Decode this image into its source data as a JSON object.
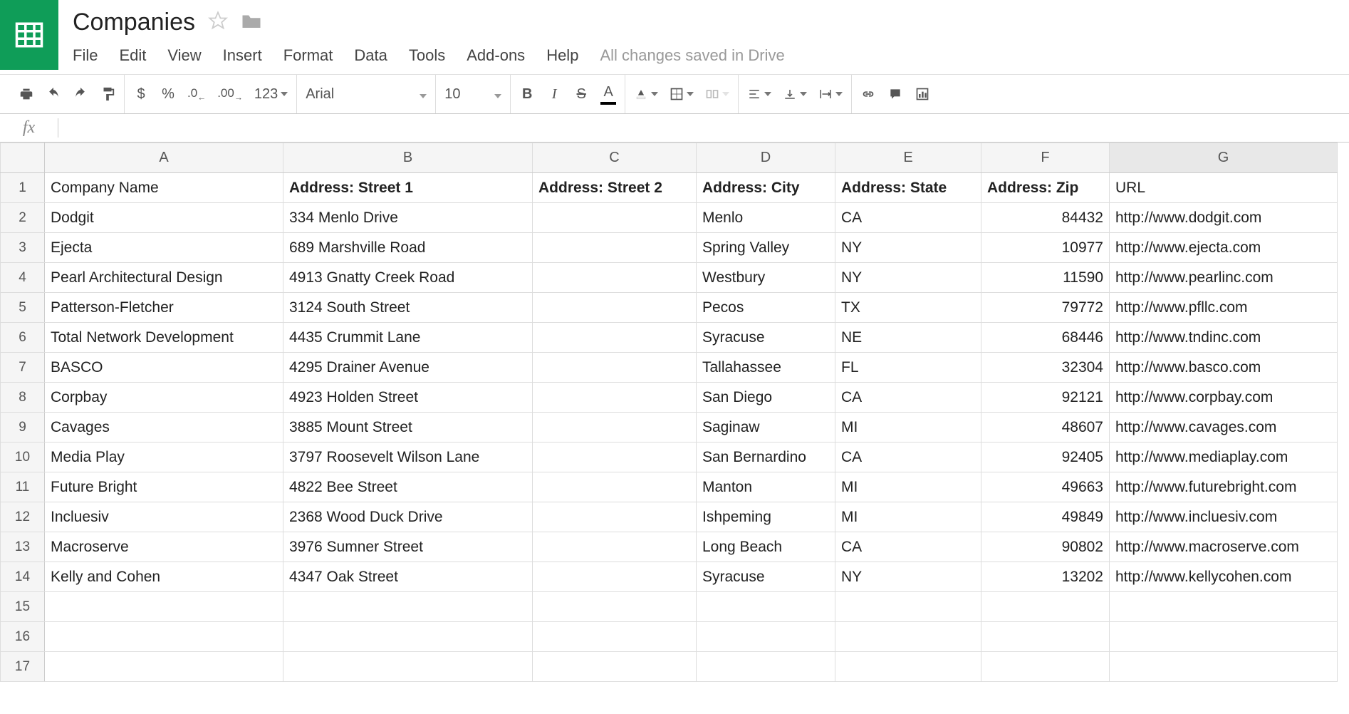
{
  "doc": {
    "title": "Companies",
    "save_status": "All changes saved in Drive"
  },
  "menu": {
    "file": "File",
    "edit": "Edit",
    "view": "View",
    "insert": "Insert",
    "format": "Format",
    "data": "Data",
    "tools": "Tools",
    "addons": "Add-ons",
    "help": "Help"
  },
  "toolbar": {
    "currency": "$",
    "percent": "%",
    "dec_dec": ".0",
    "dec_inc": ".00",
    "num_format": "123",
    "font": "Arial",
    "size": "10",
    "bold": "B",
    "italic": "I",
    "strike": "S",
    "text_color": "A"
  },
  "formula": {
    "fx": "fx",
    "value": ""
  },
  "columns": [
    "A",
    "B",
    "C",
    "D",
    "E",
    "F",
    "G"
  ],
  "selected_col_index": 6,
  "header_row": {
    "A": "Company Name",
    "B": "Address: Street 1",
    "C": "Address: Street 2",
    "D": "Address: City",
    "E": "Address: State",
    "F": "Address: Zip",
    "G": "URL",
    "bold_cols": [
      "B",
      "C",
      "D",
      "E",
      "F"
    ]
  },
  "rows": [
    {
      "A": "Dodgit",
      "B": "334 Menlo Drive",
      "C": "",
      "D": "Menlo",
      "E": "CA",
      "F": "84432",
      "G": "http://www.dodgit.com"
    },
    {
      "A": "Ejecta",
      "B": "689 Marshville Road",
      "C": "",
      "D": "Spring Valley",
      "E": "NY",
      "F": "10977",
      "G": "http://www.ejecta.com"
    },
    {
      "A": "Pearl Architectural Design",
      "B": "4913 Gnatty Creek Road",
      "C": "",
      "D": "Westbury",
      "E": "NY",
      "F": "11590",
      "G": "http://www.pearlinc.com"
    },
    {
      "A": "Patterson-Fletcher",
      "B": "3124 South Street",
      "C": "",
      "D": "Pecos",
      "E": "TX",
      "F": "79772",
      "G": "http://www.pfllc.com"
    },
    {
      "A": "Total Network Development",
      "B": "4435 Crummit Lane",
      "C": "",
      "D": "Syracuse",
      "E": "NE",
      "F": "68446",
      "G": "http://www.tndinc.com"
    },
    {
      "A": "BASCO",
      "B": "4295 Drainer Avenue",
      "C": "",
      "D": "Tallahassee",
      "E": "FL",
      "F": "32304",
      "G": "http://www.basco.com"
    },
    {
      "A": "Corpbay",
      "B": "4923 Holden Street",
      "C": "",
      "D": "San Diego",
      "E": "CA",
      "F": "92121",
      "G": "http://www.corpbay.com"
    },
    {
      "A": "Cavages",
      "B": "3885 Mount Street",
      "C": "",
      "D": "Saginaw",
      "E": "MI",
      "F": "48607",
      "G": "http://www.cavages.com"
    },
    {
      "A": "Media Play",
      "B": "3797 Roosevelt Wilson Lane",
      "C": "",
      "D": "San Bernardino",
      "E": "CA",
      "F": "92405",
      "G": "http://www.mediaplay.com"
    },
    {
      "A": "Future Bright",
      "B": "4822 Bee Street",
      "C": "",
      "D": "Manton",
      "E": "MI",
      "F": "49663",
      "G": "http://www.futurebright.com"
    },
    {
      "A": "Incluesiv",
      "B": "2368 Wood Duck Drive",
      "C": "",
      "D": "Ishpeming",
      "E": "MI",
      "F": "49849",
      "G": "http://www.incluesiv.com"
    },
    {
      "A": "Macroserve",
      "B": "3976 Sumner Street",
      "C": "",
      "D": "Long Beach",
      "E": "CA",
      "F": "90802",
      "G": "http://www.macroserve.com"
    },
    {
      "A": "Kelly and Cohen",
      "B": "4347 Oak Street",
      "C": "",
      "D": "Syracuse",
      "E": "NY",
      "F": "13202",
      "G": "http://www.kellycohen.com"
    }
  ],
  "empty_rows": [
    15,
    16,
    17
  ],
  "right_align_cols": [
    "F"
  ]
}
